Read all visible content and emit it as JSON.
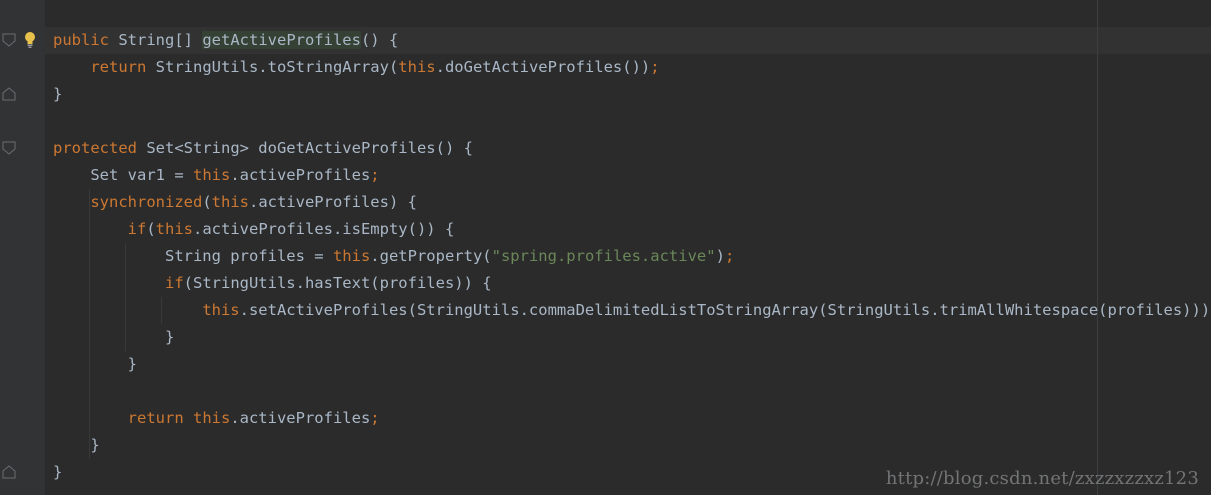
{
  "editor": {
    "lines": [
      {
        "id": "l1",
        "tokens": [
          {
            "t": "public ",
            "c": "kw"
          },
          {
            "t": "String[] "
          },
          {
            "t": "getActiveProfiles",
            "c": "hl"
          },
          {
            "t": "() {"
          }
        ]
      },
      {
        "id": "l2",
        "tokens": [
          {
            "t": "    "
          },
          {
            "t": "return ",
            "c": "kw"
          },
          {
            "t": "StringUtils.toStringArray("
          },
          {
            "t": "this",
            "c": "kw"
          },
          {
            "t": ".doGetActiveProfiles())"
          },
          {
            "t": ";",
            "c": "kw"
          }
        ]
      },
      {
        "id": "l3",
        "tokens": [
          {
            "t": "}"
          }
        ]
      },
      {
        "id": "l4",
        "tokens": [
          {
            "t": ""
          }
        ]
      },
      {
        "id": "l5",
        "tokens": [
          {
            "t": "protected ",
            "c": "kw"
          },
          {
            "t": "Set<String> doGetActiveProfiles() {"
          }
        ]
      },
      {
        "id": "l6",
        "tokens": [
          {
            "t": "    Set var1 = "
          },
          {
            "t": "this",
            "c": "kw"
          },
          {
            "t": ".activeProfiles"
          },
          {
            "t": ";",
            "c": "kw"
          }
        ]
      },
      {
        "id": "l7",
        "tokens": [
          {
            "t": "    "
          },
          {
            "t": "synchronized",
            "c": "kw"
          },
          {
            "t": "("
          },
          {
            "t": "this",
            "c": "kw"
          },
          {
            "t": ".activeProfiles) {"
          }
        ]
      },
      {
        "id": "l8",
        "tokens": [
          {
            "t": "        "
          },
          {
            "t": "if",
            "c": "kw"
          },
          {
            "t": "("
          },
          {
            "t": "this",
            "c": "kw"
          },
          {
            "t": ".activeProfiles.isEmpty()) {"
          }
        ]
      },
      {
        "id": "l9",
        "tokens": [
          {
            "t": "            String profiles = "
          },
          {
            "t": "this",
            "c": "kw"
          },
          {
            "t": ".getProperty("
          },
          {
            "t": "\"spring.profiles.active\"",
            "c": "str"
          },
          {
            "t": ")"
          },
          {
            "t": ";",
            "c": "kw"
          }
        ]
      },
      {
        "id": "l10",
        "tokens": [
          {
            "t": "            "
          },
          {
            "t": "if",
            "c": "kw"
          },
          {
            "t": "(StringUtils.hasText(profiles)) {"
          }
        ]
      },
      {
        "id": "l11",
        "tokens": [
          {
            "t": "                "
          },
          {
            "t": "this",
            "c": "kw"
          },
          {
            "t": ".setActiveProfiles(StringUtils.commaDelimitedListToStringArray(StringUtils.trimAllWhitespace(profiles)))"
          },
          {
            "t": ";",
            "c": "kw"
          }
        ]
      },
      {
        "id": "l12",
        "tokens": [
          {
            "t": "            }"
          }
        ]
      },
      {
        "id": "l13",
        "tokens": [
          {
            "t": "        }"
          }
        ]
      },
      {
        "id": "l14",
        "tokens": [
          {
            "t": ""
          }
        ]
      },
      {
        "id": "l15",
        "tokens": [
          {
            "t": "        "
          },
          {
            "t": "return ",
            "c": "kw"
          },
          {
            "t": "this",
            "c": "kw"
          },
          {
            "t": ".activeProfiles"
          },
          {
            "t": ";",
            "c": "kw"
          }
        ]
      },
      {
        "id": "l16",
        "tokens": [
          {
            "t": "    }"
          }
        ]
      },
      {
        "id": "l17",
        "tokens": [
          {
            "t": "}"
          }
        ]
      }
    ]
  },
  "watermark": {
    "text": "http://blog.csdn.net/zxzzxzzxz123"
  },
  "colors": {
    "background": "#2b2b2b",
    "gutter": "#313335",
    "keyword": "#cc7832",
    "string": "#6a8759",
    "text": "#a9b7c6",
    "highlight": "#344134",
    "bulb": "#e8c14a"
  },
  "icons": {
    "bulb": "lightbulb-icon",
    "fold": "fold-marker-icon"
  }
}
